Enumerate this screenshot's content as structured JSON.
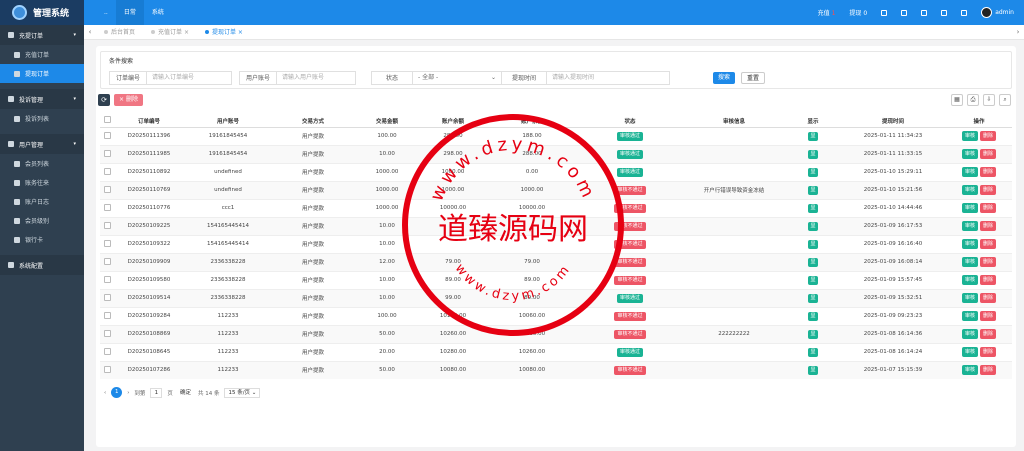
{
  "header": {
    "app_title": "管理系统",
    "nav": [
      "..",
      "日常",
      "系统"
    ],
    "recharge_label": "充值",
    "recharge_count": "1",
    "withdraw_label": "提现",
    "withdraw_count": "0",
    "user": "admin"
  },
  "sidebar": {
    "groups": [
      {
        "label": "充提订单",
        "items": [
          "充值订单",
          "提现订单"
        ]
      },
      {
        "label": "投诉管理",
        "items": [
          "投诉列表"
        ]
      },
      {
        "label": "用户管理",
        "items": [
          "会员列表",
          "账务往来",
          "账户日志",
          "会员级别",
          "银行卡"
        ]
      },
      {
        "label": "系统配置",
        "items": []
      }
    ],
    "active_item": "提现订单"
  },
  "tabs": [
    "后台首页",
    "充值订单",
    "提现订单"
  ],
  "search": {
    "title": "条件搜索",
    "order_label": "订单编号",
    "order_placeholder": "请输入订单编号",
    "account_label": "用户账号",
    "account_placeholder": "请输入用户账号",
    "status_label": "状态",
    "status_value": "- 全部 -",
    "time_label": "提现时间",
    "time_placeholder": "请输入提现时间",
    "search_btn": "搜索",
    "reset_btn": "重置"
  },
  "toolbar": {
    "delete_label": "删除"
  },
  "table": {
    "columns": [
      "订单编号",
      "用户账号",
      "交易方式",
      "交易金额",
      "账户余额",
      "账户余额",
      "状态",
      "审核信息",
      "显示",
      "提现时间",
      "操作"
    ],
    "display_label": "显",
    "audit_label": "审核",
    "delete_label": "删除",
    "rows": [
      {
        "order": "D20250111396",
        "account": "19161845454",
        "method": "用户提款",
        "amount": "100.00",
        "balance1": "288.00",
        "balance2": "188.00",
        "status": "审核通过",
        "status_type": "ok",
        "info": "",
        "time": "2025-01-11 11:34:23"
      },
      {
        "order": "D20250111985",
        "account": "19161845454",
        "method": "用户提款",
        "amount": "10.00",
        "balance1": "298.00",
        "balance2": "288.00",
        "status": "审核通过",
        "status_type": "ok",
        "info": "",
        "time": "2025-01-11 11:33:15"
      },
      {
        "order": "D20250110892",
        "account": "undefined",
        "method": "用户提款",
        "amount": "1000.00",
        "balance1": "1000.00",
        "balance2": "0.00",
        "status": "审核通过",
        "status_type": "ok",
        "info": "",
        "time": "2025-01-10 15:29:11"
      },
      {
        "order": "D20250110769",
        "account": "undefined",
        "method": "用户提款",
        "amount": "1000.00",
        "balance1": "1000.00",
        "balance2": "1000.00",
        "status": "审核不通过",
        "status_type": "no",
        "info": "开户行错误导致资金冻结",
        "time": "2025-01-10 15:21:56"
      },
      {
        "order": "D20250110776",
        "account": "ccc1",
        "method": "用户提款",
        "amount": "1000.00",
        "balance1": "10000.00",
        "balance2": "10000.00",
        "status": "审核不通过",
        "status_type": "no",
        "info": "",
        "time": "2025-01-10 14:44:46"
      },
      {
        "order": "D20250109225",
        "account": "154165445414",
        "method": "用户提款",
        "amount": "10.00",
        "balance1": "",
        "balance2": "",
        "status": "审核不通过",
        "status_type": "no",
        "info": "",
        "time": "2025-01-09 16:17:53"
      },
      {
        "order": "D20250109322",
        "account": "154165445414",
        "method": "用户提款",
        "amount": "10.00",
        "balance1": "",
        "balance2": "",
        "status": "审核不通过",
        "status_type": "no",
        "info": "",
        "time": "2025-01-09 16:16:40"
      },
      {
        "order": "D20250109909",
        "account": "2336338228",
        "method": "用户提款",
        "amount": "12.00",
        "balance1": "79.00",
        "balance2": "79.00",
        "status": "审核不通过",
        "status_type": "no",
        "info": "",
        "time": "2025-01-09 16:08:14"
      },
      {
        "order": "D20250109580",
        "account": "2336338228",
        "method": "用户提款",
        "amount": "10.00",
        "balance1": "89.00",
        "balance2": "89.00",
        "status": "审核不通过",
        "status_type": "no",
        "info": "",
        "time": "2025-01-09 15:57:45"
      },
      {
        "order": "D20250109514",
        "account": "2336338228",
        "method": "用户提款",
        "amount": "10.00",
        "balance1": "99.00",
        "balance2": "89.00",
        "status": "审核通过",
        "status_type": "ok",
        "info": "",
        "time": "2025-01-09 15:32:51"
      },
      {
        "order": "D20250109284",
        "account": "112233",
        "method": "用户提款",
        "amount": "100.00",
        "balance1": "10160.00",
        "balance2": "10060.00",
        "status": "审核不通过",
        "status_type": "no",
        "info": "",
        "time": "2025-01-09 09:23:23"
      },
      {
        "order": "D20250108869",
        "account": "112233",
        "method": "用户提款",
        "amount": "50.00",
        "balance1": "10260.00",
        "balance2": "10260.00",
        "status": "审核不通过",
        "status_type": "no",
        "info": "222222222",
        "time": "2025-01-08 16:14:36"
      },
      {
        "order": "D20250108645",
        "account": "112233",
        "method": "用户提款",
        "amount": "20.00",
        "balance1": "10280.00",
        "balance2": "10260.00",
        "status": "审核通过",
        "status_type": "ok",
        "info": "",
        "time": "2025-01-08 16:14:24"
      },
      {
        "order": "D20250107286",
        "account": "112233",
        "method": "用户提款",
        "amount": "50.00",
        "balance1": "10080.00",
        "balance2": "10080.00",
        "status": "审核不通过",
        "status_type": "no",
        "info": "",
        "time": "2025-01-07 15:15:39"
      }
    ]
  },
  "pagination": {
    "current": "1",
    "goto_label": "到第",
    "page_input": "1",
    "page_unit": "页",
    "confirm_label": "确定",
    "total": "共 14 条",
    "per_page": "15 条/页"
  },
  "watermark": {
    "text": "道臻源码网",
    "url_top": "www.dzym.com",
    "url_bottom": "www.dzym.com",
    "color": "#e60012"
  }
}
